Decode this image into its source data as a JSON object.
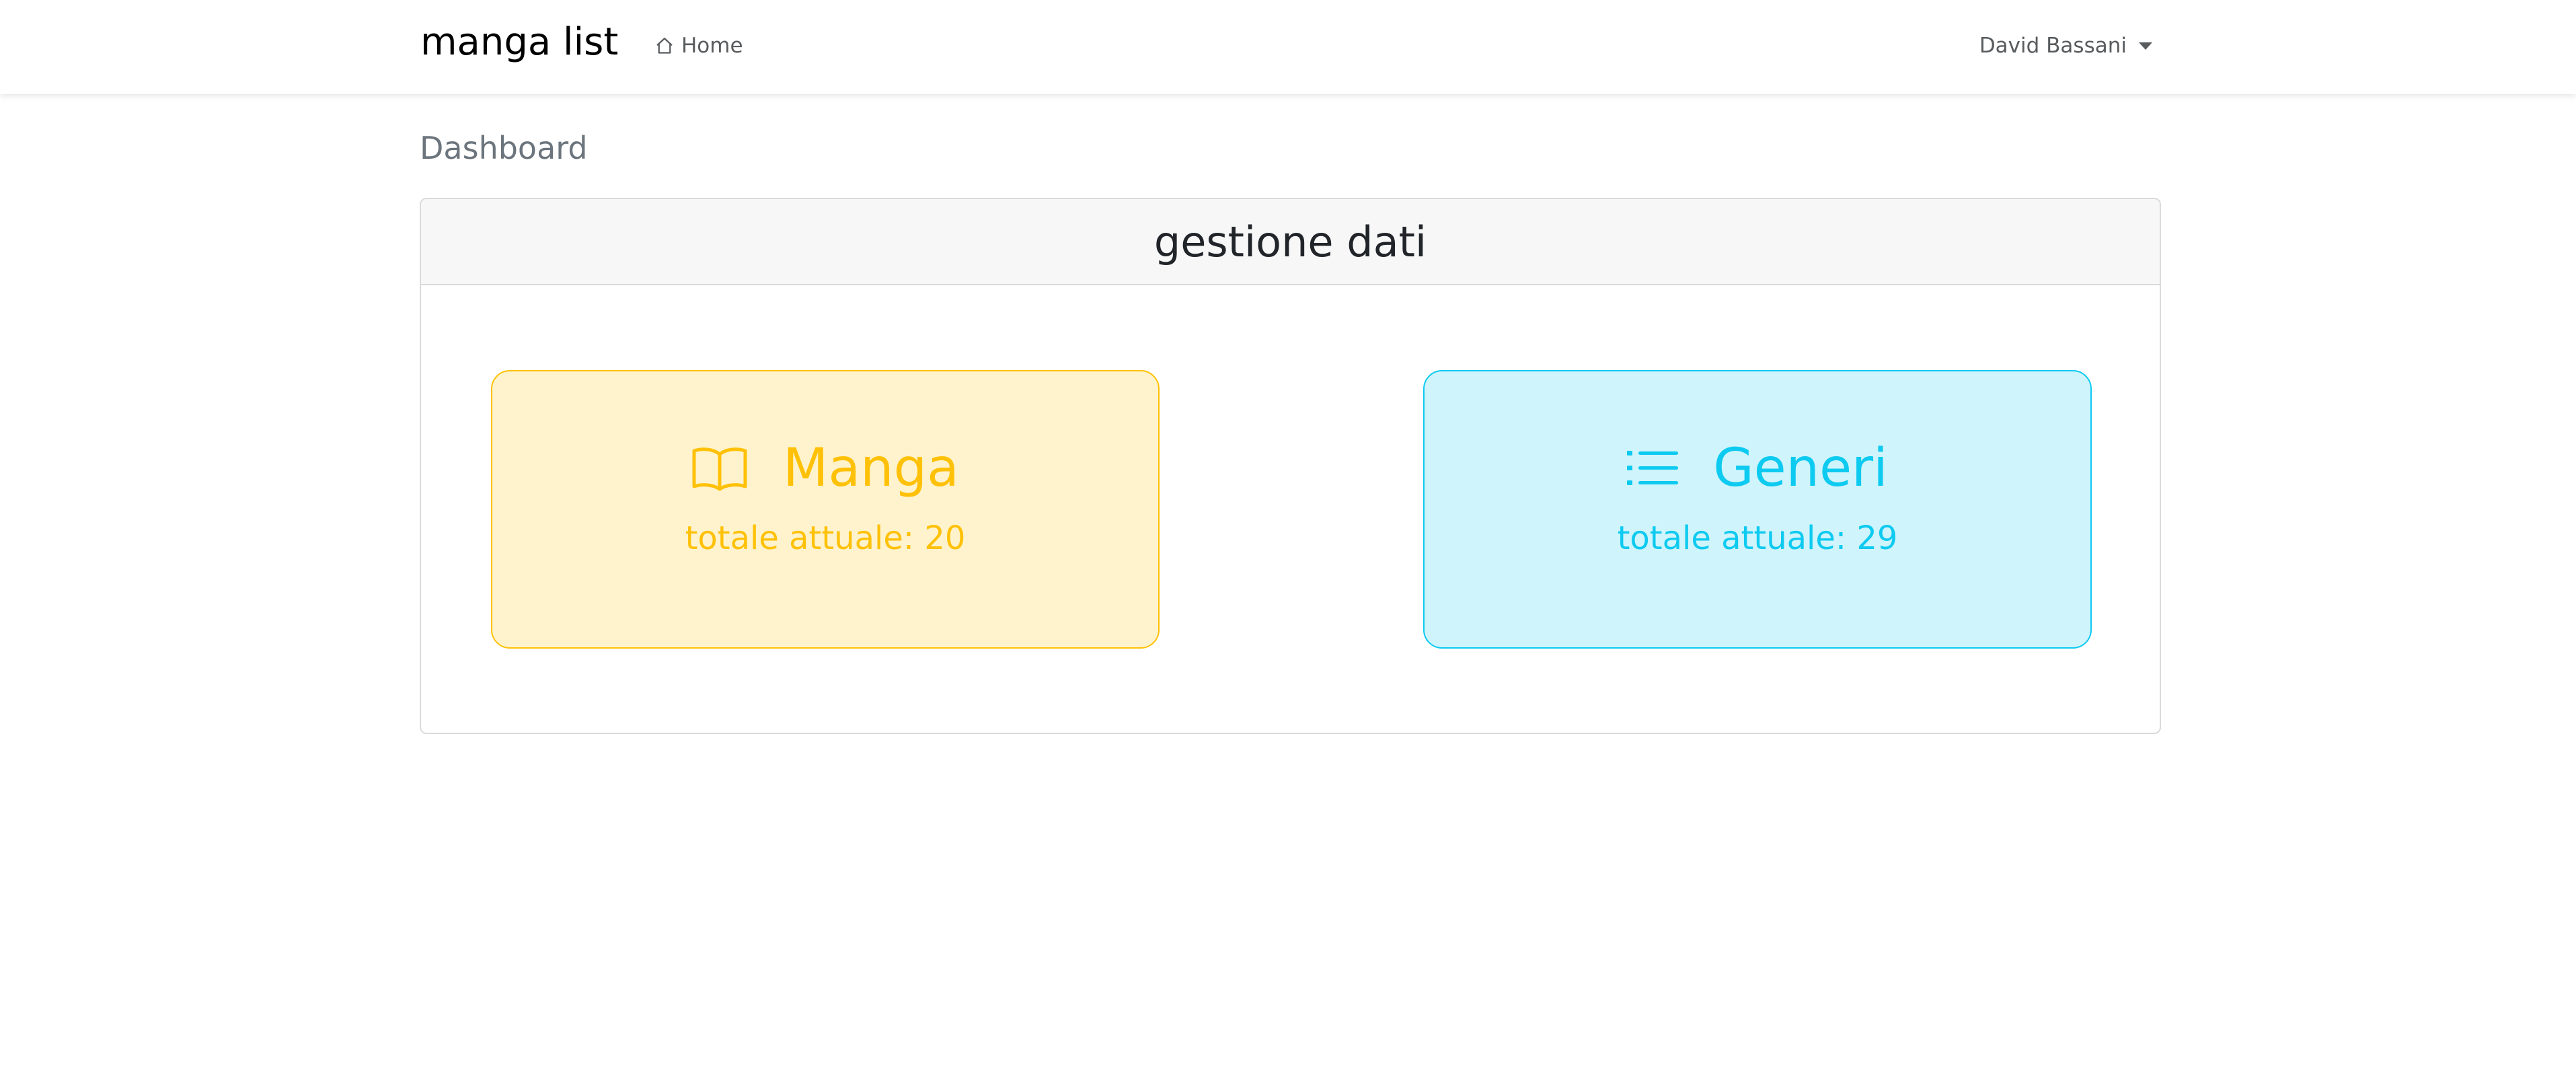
{
  "navbar": {
    "brand": "manga list",
    "home_label": "Home",
    "home_icon": "house-icon",
    "user_name": "David Bassani"
  },
  "page": {
    "title": "Dashboard"
  },
  "card": {
    "header": "gestione dati",
    "tiles": [
      {
        "icon": "open-book-icon",
        "label": "Manga",
        "count_text": "totale attuale: 20",
        "color": "#ffc107",
        "background": "#fff3cd"
      },
      {
        "icon": "list-icon",
        "label": "Generi",
        "count_text": "totale attuale: 29",
        "color": "#0dcaf0",
        "background": "#cff4fc"
      }
    ]
  }
}
